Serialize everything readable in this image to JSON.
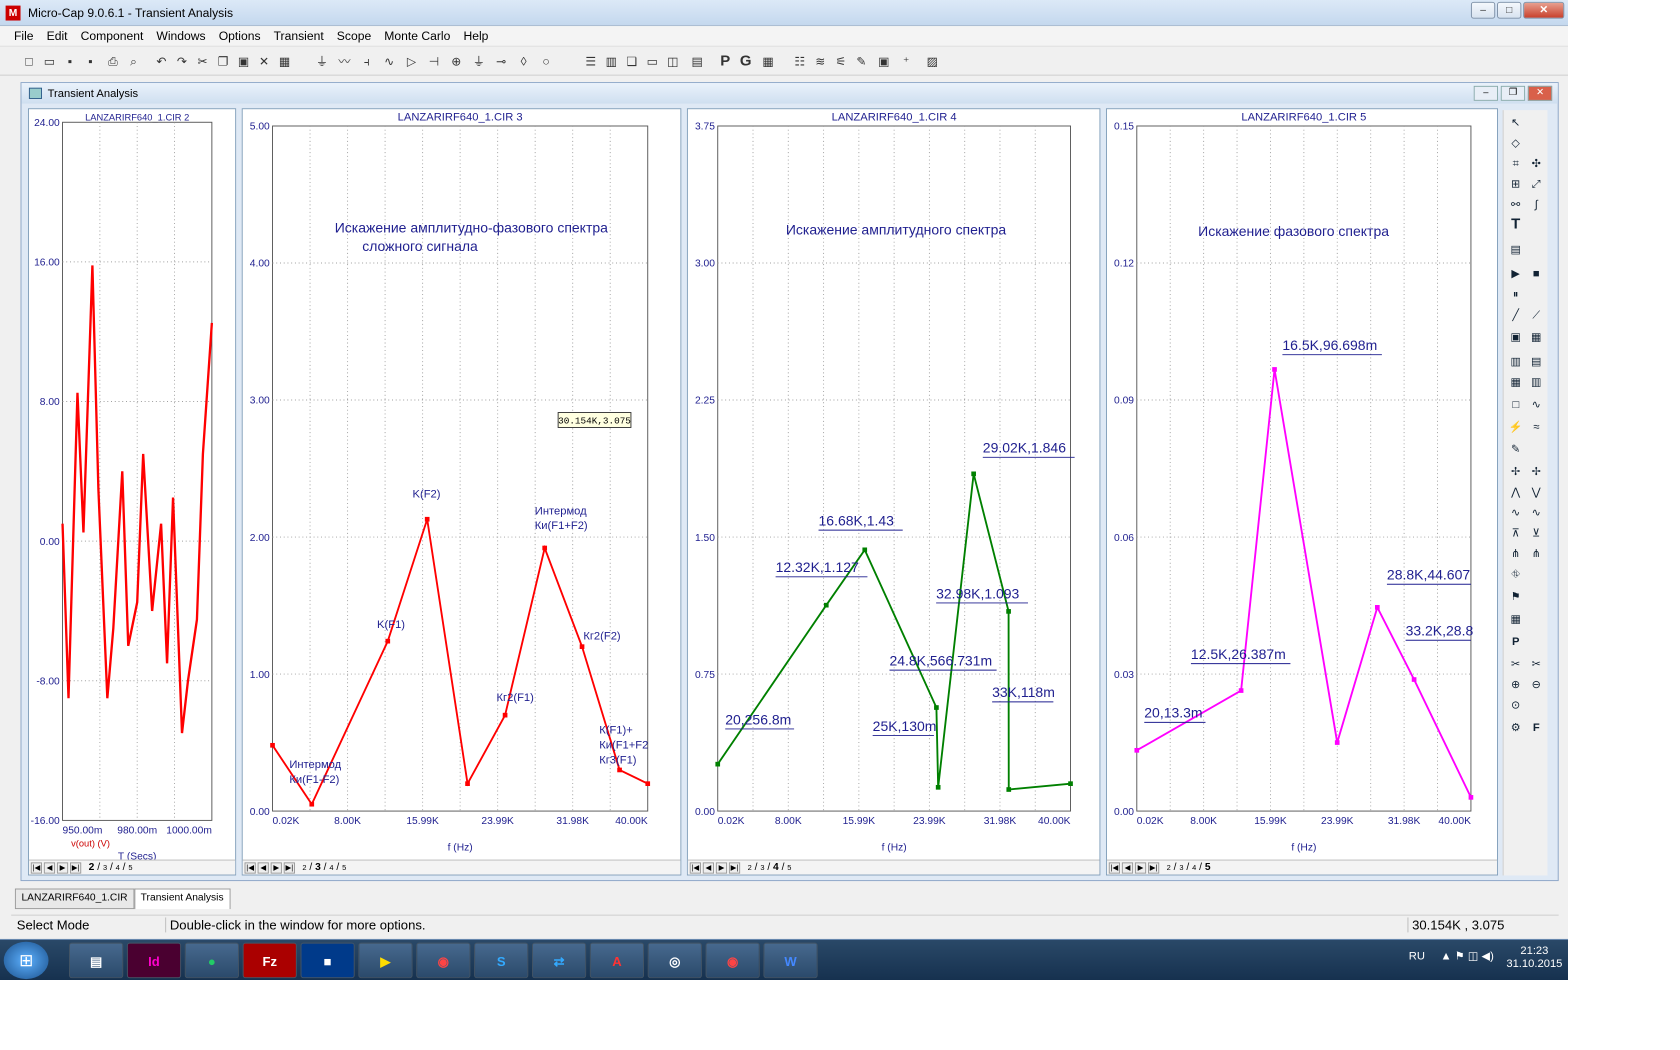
{
  "window": {
    "title": "Micro-Cap 9.0.6.1 - Transient Analysis",
    "controls": {
      "min": "–",
      "max": "□",
      "close": "✕"
    }
  },
  "menu": [
    "File",
    "Edit",
    "Component",
    "Windows",
    "Options",
    "Transient",
    "Scope",
    "Monte Carlo",
    "Help"
  ],
  "toolbar_icons": [
    "new",
    "open",
    "save",
    "save-all",
    "print",
    "print-preview",
    "undo",
    "redo",
    "cut",
    "copy",
    "paste",
    "delete",
    "select-all",
    "wire",
    "resistor",
    "capacitor",
    "inductor",
    "diode",
    "transistor",
    "source",
    "ground",
    "probe",
    "tile-horizontal",
    "tile-vertical",
    "cascade",
    "maximize",
    "split",
    "calculator",
    "P",
    "G",
    "grid"
  ],
  "mdi": {
    "title": "Transient Analysis"
  },
  "panels": [
    {
      "title": "LANZARIRF640_1.CIR 2",
      "y_ticks": [
        "24.00",
        "16.00",
        "8.00",
        "0.00",
        "-8.00",
        "-16.00"
      ],
      "x_ticks": [
        "950.00m",
        "980.00m",
        "1000.00m"
      ],
      "ylabel": "v(out) (V)",
      "xlabel": "T (Secs)",
      "tabs": [
        "2",
        "3",
        "4",
        "5"
      ],
      "active_tab": "2"
    },
    {
      "title": "LANZARIRF640_1.CIR 3",
      "y_ticks": [
        "5.00",
        "4.00",
        "3.00",
        "2.00",
        "1.00",
        "0.00"
      ],
      "x_ticks": [
        "0.02K",
        "8.00K",
        "15.99K",
        "23.99K",
        "31.98K",
        "40.00K"
      ],
      "xlabel": "f (Hz)",
      "heading": "Искажение амплитудно-фазового спектра",
      "heading2": "сложного сигнала",
      "tabs": [
        "2",
        "3",
        "4",
        "5"
      ],
      "active_tab": "3",
      "tooltip": "30.154K,3.075",
      "labels": [
        "Интермод",
        "Ки(F1-F2)",
        "K(F1)",
        "K(F2)",
        "Кг2(F1)",
        "Интермод",
        "Ки(F1+F2)",
        "Кг2(F2)",
        "К(F1)+",
        "Ки(F1+F2",
        "Кг3(F1)"
      ]
    },
    {
      "title": "LANZARIRF640_1.CIR 4",
      "y_ticks": [
        "3.75",
        "3.00",
        "2.25",
        "1.50",
        "0.75",
        "0.00"
      ],
      "x_ticks": [
        "0.02K",
        "8.00K",
        "15.99K",
        "23.99K",
        "31.98K",
        "40.00K"
      ],
      "xlabel": "f (Hz)",
      "heading": "Искажение амплитудного спектра",
      "tabs": [
        "2",
        "3",
        "4",
        "5"
      ],
      "active_tab": "4",
      "labels": [
        "20,256.8m",
        "12.32K,1.127",
        "16.68K,1.43",
        "25K,130m",
        "24.8K,566.731m",
        "29.02K,1.846",
        "32.98K,1.093",
        "33K,118m"
      ]
    },
    {
      "title": "LANZARIRF640_1.CIR 5",
      "y_ticks": [
        "0.15",
        "0.12",
        "0.09",
        "0.06",
        "0.03",
        "0.00"
      ],
      "x_ticks": [
        "0.02K",
        "8.00K",
        "15.99K",
        "23.99K",
        "31.98K",
        "40.00K"
      ],
      "xlabel": "f (Hz)",
      "heading": "Искажение фазового спектра",
      "tabs": [
        "2",
        "3",
        "4",
        "5"
      ],
      "active_tab": "5",
      "labels": [
        "20,13.3m",
        "12.5K,26.387m",
        "16.5K,96.698m",
        "28.8K,44.607",
        "33.2K,28.8"
      ]
    }
  ],
  "chart_data": [
    {
      "type": "line",
      "title": "LANZARIRF640_1.CIR 2",
      "xlabel": "T (Secs)",
      "ylabel": "v(out) (V)",
      "xlim": [
        0.95,
        1.0
      ],
      "ylim": [
        -16,
        24
      ],
      "series": [
        {
          "name": "v(out) (V)",
          "color": "#ff0000",
          "x": [
            0.95,
            0.952,
            0.955,
            0.957,
            0.96,
            0.962,
            0.965,
            0.967,
            0.97,
            0.972,
            0.975,
            0.977,
            0.98,
            0.983,
            0.985,
            0.987,
            0.99,
            0.992,
            0.995,
            0.997,
            1.0
          ],
          "y": [
            1.0,
            -9.0,
            8.5,
            0.5,
            15.8,
            3.0,
            -9.0,
            -5.0,
            4.0,
            -6.0,
            -3.5,
            5.0,
            -4.0,
            1.0,
            -7.0,
            2.5,
            -11.0,
            -8.0,
            -4.5,
            5.0,
            12.5
          ]
        }
      ]
    },
    {
      "type": "line",
      "title": "LANZARIRF640_1.CIR 3",
      "xlabel": "f (Hz)",
      "xlim": [
        0.02,
        40.0
      ],
      "ylim": [
        0,
        5
      ],
      "series": [
        {
          "color": "#ff0000",
          "x": [
            0.02,
            4.2,
            12.3,
            16.5,
            20.8,
            24.8,
            29.02,
            33.0,
            37.0,
            40.0
          ],
          "y": [
            0.48,
            0.05,
            1.24,
            2.13,
            0.2,
            0.7,
            1.92,
            1.2,
            0.3,
            0.2
          ]
        }
      ]
    },
    {
      "type": "line",
      "title": "LANZARIRF640_1.CIR 4",
      "xlabel": "f (Hz)",
      "xlim": [
        0.02,
        40.0
      ],
      "ylim": [
        0,
        3.75
      ],
      "series": [
        {
          "color": "#008000",
          "x": [
            0.02,
            12.32,
            16.68,
            24.8,
            25.0,
            29.02,
            32.98,
            33.0,
            40.0
          ],
          "y": [
            0.2568,
            1.127,
            1.43,
            0.5667,
            0.13,
            1.846,
            1.093,
            0.118,
            0.15
          ]
        }
      ]
    },
    {
      "type": "line",
      "title": "LANZARIRF640_1.CIR 5",
      "xlabel": "f (Hz)",
      "xlim": [
        0.02,
        40.0
      ],
      "ylim": [
        0,
        0.15
      ],
      "series": [
        {
          "color": "#ff00ff",
          "x": [
            0.02,
            12.5,
            16.5,
            24.0,
            28.8,
            33.2,
            40.0
          ],
          "y": [
            0.0133,
            0.026387,
            0.096698,
            0.015,
            0.044607,
            0.0288,
            0.003
          ]
        }
      ]
    }
  ],
  "doc_tabs": [
    "LANZARIRF640_1.CIR",
    "Transient Analysis"
  ],
  "status": {
    "mode": "Select Mode",
    "hint": "Double-click in the window for more options.",
    "coords": "30.154K , 3.075"
  },
  "taskbar": {
    "apps": [
      "explorer",
      "indesign",
      "app",
      "filezilla",
      "app",
      "video",
      "chrome",
      "skype",
      "teamviewer",
      "acrobat",
      "app",
      "chrome",
      "word"
    ],
    "lang": "RU",
    "time": "21:23",
    "date": "31.10.2015"
  },
  "colors": {
    "red": "#ff0000",
    "green": "#008000",
    "magenta": "#ff00ff",
    "axis_blue": "#1f1f8f"
  }
}
